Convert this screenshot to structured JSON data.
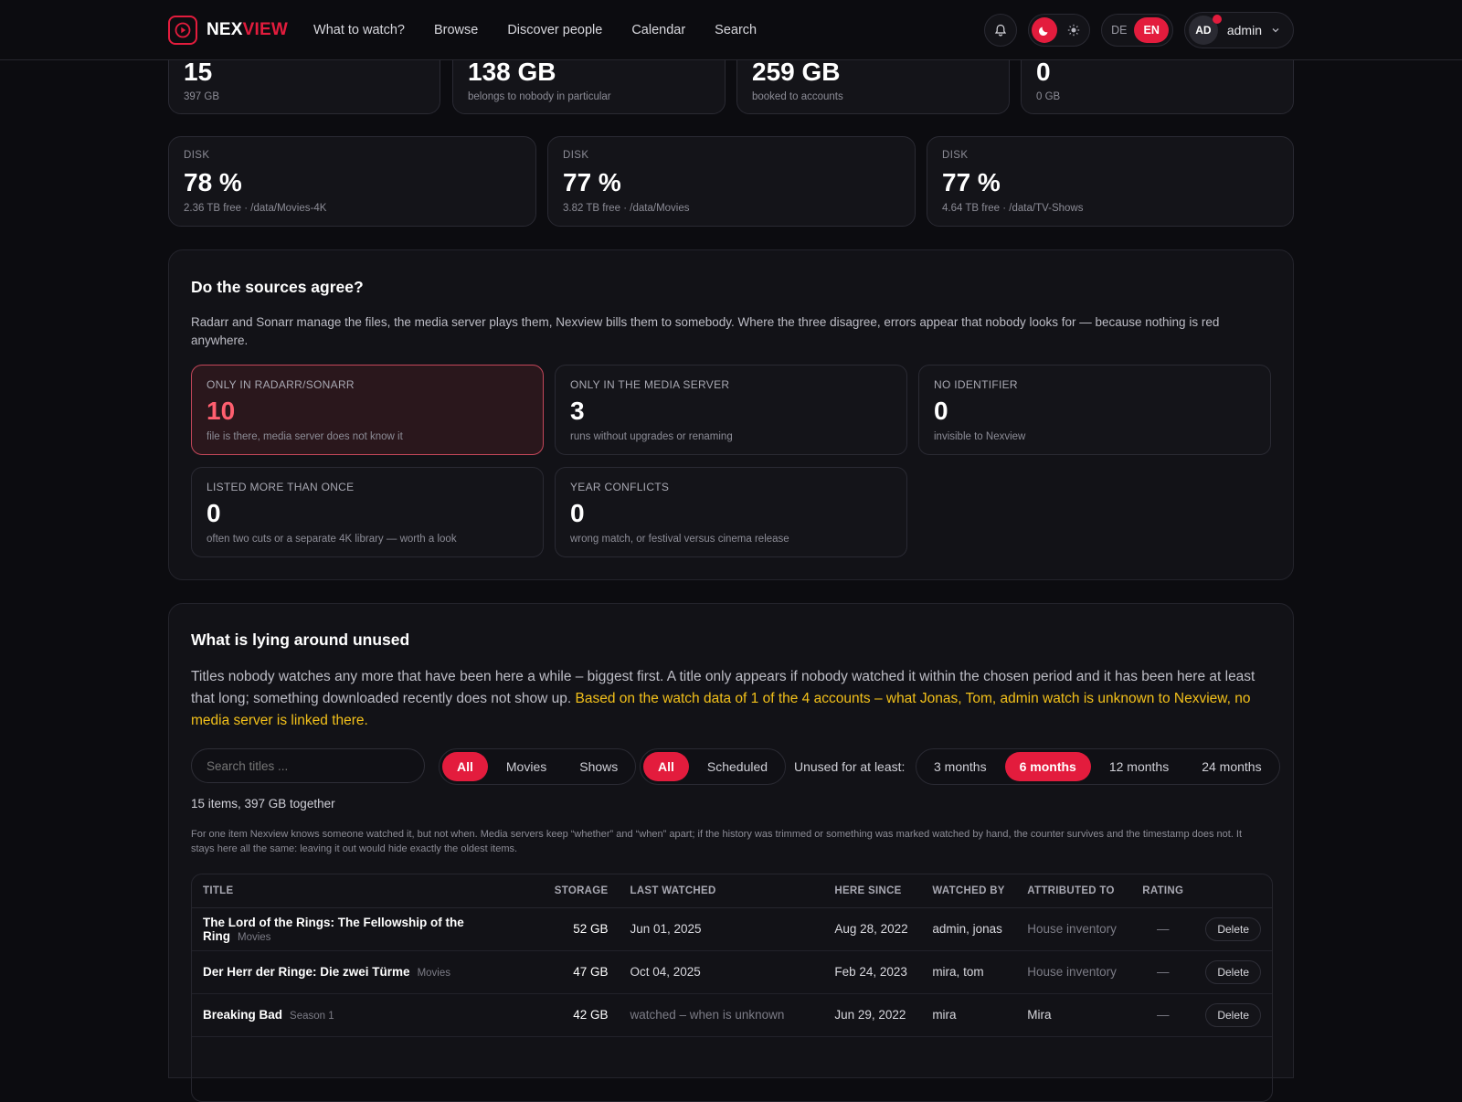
{
  "brand": {
    "part1": "NEX",
    "part2": "VIEW"
  },
  "nav": [
    "What to watch?",
    "Browse",
    "Discover people",
    "Calendar",
    "Search"
  ],
  "lang": {
    "de": "DE",
    "en": "EN"
  },
  "user": {
    "initials": "AD",
    "name": "admin"
  },
  "top_stats": [
    {
      "value": "15",
      "sub": "397 GB"
    },
    {
      "value": "138 GB",
      "sub": "belongs to nobody in particular"
    },
    {
      "value": "259 GB",
      "sub": "booked to accounts"
    },
    {
      "value": "0",
      "sub": "0 GB"
    }
  ],
  "disks": [
    {
      "label": "DISK",
      "value": "78 %",
      "sub": "2.36 TB free · /data/Movies-4K"
    },
    {
      "label": "DISK",
      "value": "77 %",
      "sub": "3.82 TB free · /data/Movies"
    },
    {
      "label": "DISK",
      "value": "77 %",
      "sub": "4.64 TB free · /data/TV-Shows"
    }
  ],
  "sources": {
    "title": "Do the sources agree?",
    "desc": "Radarr and Sonarr manage the files, the media server plays them, Nexview bills them to somebody. Where the three disagree, errors appear that nobody looks for — because nothing is red anywhere.",
    "cards": [
      {
        "label": "ONLY IN RADARR/SONARR",
        "value": "10",
        "sub": "file is there, media server does not know it"
      },
      {
        "label": "ONLY IN THE MEDIA SERVER",
        "value": "3",
        "sub": "runs without upgrades or renaming"
      },
      {
        "label": "NO IDENTIFIER",
        "value": "0",
        "sub": "invisible to Nexview"
      },
      {
        "label": "LISTED MORE THAN ONCE",
        "value": "0",
        "sub": "often two cuts or a separate 4K library — worth a look"
      },
      {
        "label": "YEAR CONFLICTS",
        "value": "0",
        "sub": "wrong match, or festival versus cinema release"
      }
    ]
  },
  "unused": {
    "title": "What is lying around unused",
    "desc": "Titles nobody watches any more that have been here a while – biggest first. A title only appears if nobody watched it within the chosen period and it has been here at least that long; something downloaded recently does not show up. ",
    "highlight": "Based on the watch data of 1 of the 4 accounts – what Jonas, Tom, admin watch is unknown to Nexview, no media server is linked there.",
    "search_placeholder": "Search titles ...",
    "type_filter": [
      "All",
      "Movies",
      "Shows"
    ],
    "status_filter": [
      "All",
      "Scheduled"
    ],
    "period_label": "Unused for at least:",
    "periods": [
      "3 months",
      "6 months",
      "12 months",
      "24 months"
    ],
    "count_line": "15 items, 397 GB together",
    "note": "For one item Nexview knows someone watched it, but not when. Media servers keep “whether” and “when” apart; if the history was trimmed or something was marked watched by hand, the counter survives and the timestamp does not. It stays here all the same: leaving it out would hide exactly the oldest items.",
    "columns": [
      "TITLE",
      "STORAGE",
      "LAST WATCHED",
      "HERE SINCE",
      "WATCHED BY",
      "ATTRIBUTED TO",
      "RATING"
    ],
    "rows": [
      {
        "title": "The Lord of the Rings: The Fellowship of the Ring",
        "kind": "Movies",
        "storage": "52 GB",
        "last": "Jun 01, 2025",
        "since": "Aug 28, 2022",
        "by": "admin, jonas",
        "attr": "House inventory",
        "rating": "—",
        "action": "Delete"
      },
      {
        "title": "Der Herr der Ringe: Die zwei Türme",
        "kind": "Movies",
        "storage": "47 GB",
        "last": "Oct 04, 2025",
        "since": "Feb 24, 2023",
        "by": "mira, tom",
        "attr": "House inventory",
        "rating": "—",
        "action": "Delete"
      },
      {
        "title": "Breaking Bad",
        "kind": "Season 1",
        "storage": "42 GB",
        "last": "watched – when is unknown",
        "since": "Jun 29, 2022",
        "by": "mira",
        "attr": "Mira",
        "rating": "—",
        "action": "Delete"
      }
    ]
  },
  "colors": {
    "accent": "#e31c3d",
    "highlight": "#f2c01a",
    "background": "#0c0c10",
    "card": "#141419"
  }
}
